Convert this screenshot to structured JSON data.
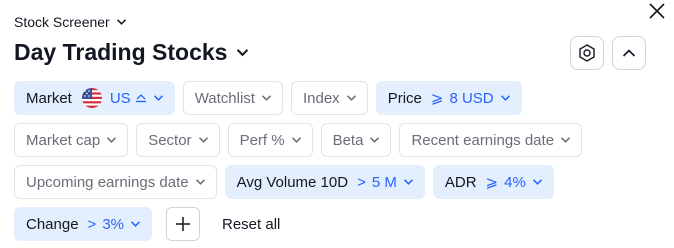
{
  "header": {
    "screener_label": "Stock Screener",
    "title": "Day Trading Stocks"
  },
  "filters": {
    "market": {
      "label": "Market",
      "value": "US"
    },
    "watchlist": {
      "label": "Watchlist"
    },
    "index": {
      "label": "Index"
    },
    "price": {
      "label": "Price",
      "operator": "⩾",
      "value": "8 USD"
    },
    "market_cap": {
      "label": "Market cap"
    },
    "sector": {
      "label": "Sector"
    },
    "perf": {
      "label": "Perf %"
    },
    "beta": {
      "label": "Beta"
    },
    "recent_earnings": {
      "label": "Recent earnings date"
    },
    "upcoming_earnings": {
      "label": "Upcoming earnings date"
    },
    "avg_volume": {
      "label": "Avg Volume 10D",
      "operator": ">",
      "value": "5 M"
    },
    "adr": {
      "label": "ADR",
      "operator": "⩾",
      "value": "4%"
    },
    "change": {
      "label": "Change",
      "operator": ">",
      "value": "3%"
    }
  },
  "actions": {
    "reset_label": "Reset all"
  },
  "colors": {
    "accent": "#2962ff",
    "active_bg": "#e3effd",
    "border": "#e0e3eb"
  },
  "icons": [
    "close-icon",
    "chevron-down-icon",
    "settings-hexagon-icon",
    "chevron-up-icon",
    "us-flag-icon",
    "plus-icon"
  ]
}
